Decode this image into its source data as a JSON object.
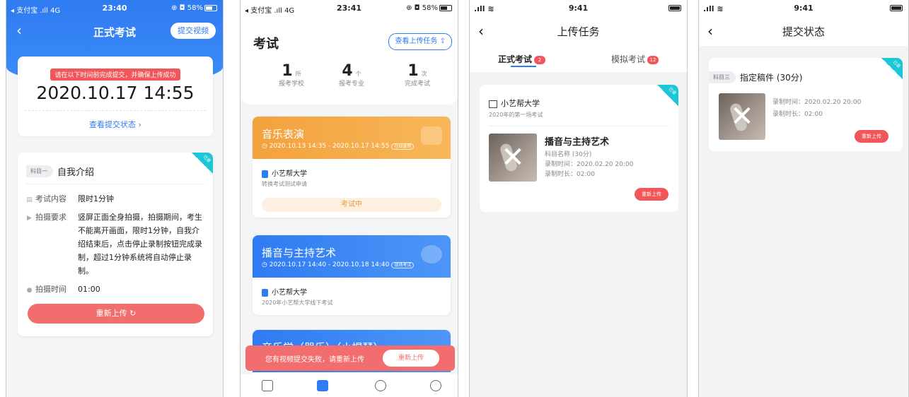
{
  "p1": {
    "status": {
      "left": "◂ 支付宝 .ıll 4G",
      "time": "23:40",
      "right": "⊕ ◘ 58%"
    },
    "title": "正式考试",
    "submit_video": "提交视频",
    "warning": "请在以下时间前完成提交，并确保上传成功",
    "deadline": "2020.10.17 14:55",
    "view_status": "查看提交状态 ›",
    "ribbon": "已录",
    "subject_tag": "科目一",
    "subject_title": "自我介绍",
    "rows": [
      {
        "label": "考试内容",
        "value": "限时1分钟"
      },
      {
        "label": "拍摄要求",
        "value": "竖屏正面全身拍摄，拍摄期间，考生不能离开画面，限时1分钟，自我介绍结束后，点击停止录制按钮完成录制，超过1分钟系统将自动停止录制。"
      },
      {
        "label": "拍摄时间",
        "value": "01:00"
      }
    ],
    "retry": "重新上传 ↻"
  },
  "p2": {
    "status": {
      "left": "◂ 支付宝 .ıll 4G",
      "time": "23:41",
      "right": "⊕ ◘ 58%"
    },
    "title": "考试",
    "view_upload": "查看上传任务 ⇪",
    "stats": [
      {
        "n": "1",
        "u": "所",
        "label": "报考学校"
      },
      {
        "n": "4",
        "u": "个",
        "label": "报考专业"
      },
      {
        "n": "1",
        "u": "次",
        "label": "完成考试"
      }
    ],
    "exams": [
      {
        "title": "音乐表演",
        "date": "◷ 2020.10.13 14:35 - 2020.10.17 14:55",
        "chip": "在线录制",
        "school": "小艺帮大学",
        "desc": "转换考试测试申请",
        "state": "考试中"
      },
      {
        "title": "播音与主持艺术",
        "date": "◷ 2020.10.17 14:40 - 2020.10.18 14:40",
        "chip": "现场考试",
        "school": "小艺帮大学",
        "desc": "2020年小艺帮大学线下考试"
      },
      {
        "title": "音乐学（器乐）（小提琴）"
      }
    ],
    "toast": {
      "message": "您有视频提交失败，请重新上传",
      "button": "重新上传"
    }
  },
  "p3": {
    "status": {
      "left": ".ıll ≋",
      "time": "9:41"
    },
    "title": "上传任务",
    "tabs": [
      {
        "label": "正式考试",
        "count": "2"
      },
      {
        "label": "模拟考试",
        "count": "12"
      }
    ],
    "ribbon": "已录",
    "university": "小艺帮大学",
    "university_sub": "2020年的第一场考试",
    "item_name": "播音与主持艺术",
    "item_meta": [
      "科目名称 (30分)",
      "录制时间：2020.02.20 20:00",
      "录制时长：02:00"
    ],
    "reupload": "重新上传",
    "thumb_mark": "✕"
  },
  "p4": {
    "status": {
      "left": ".ıll ≋",
      "time": "9:41"
    },
    "title": "提交状态",
    "ribbon": "已录",
    "subject_tag": "科目三",
    "subject_title": "指定稿件 (30分)",
    "item_meta": [
      "录制时间：2020.02.20 20:00",
      "录制时长：02:00"
    ],
    "reupload": "重新上传",
    "thumb_mark": "✕"
  }
}
